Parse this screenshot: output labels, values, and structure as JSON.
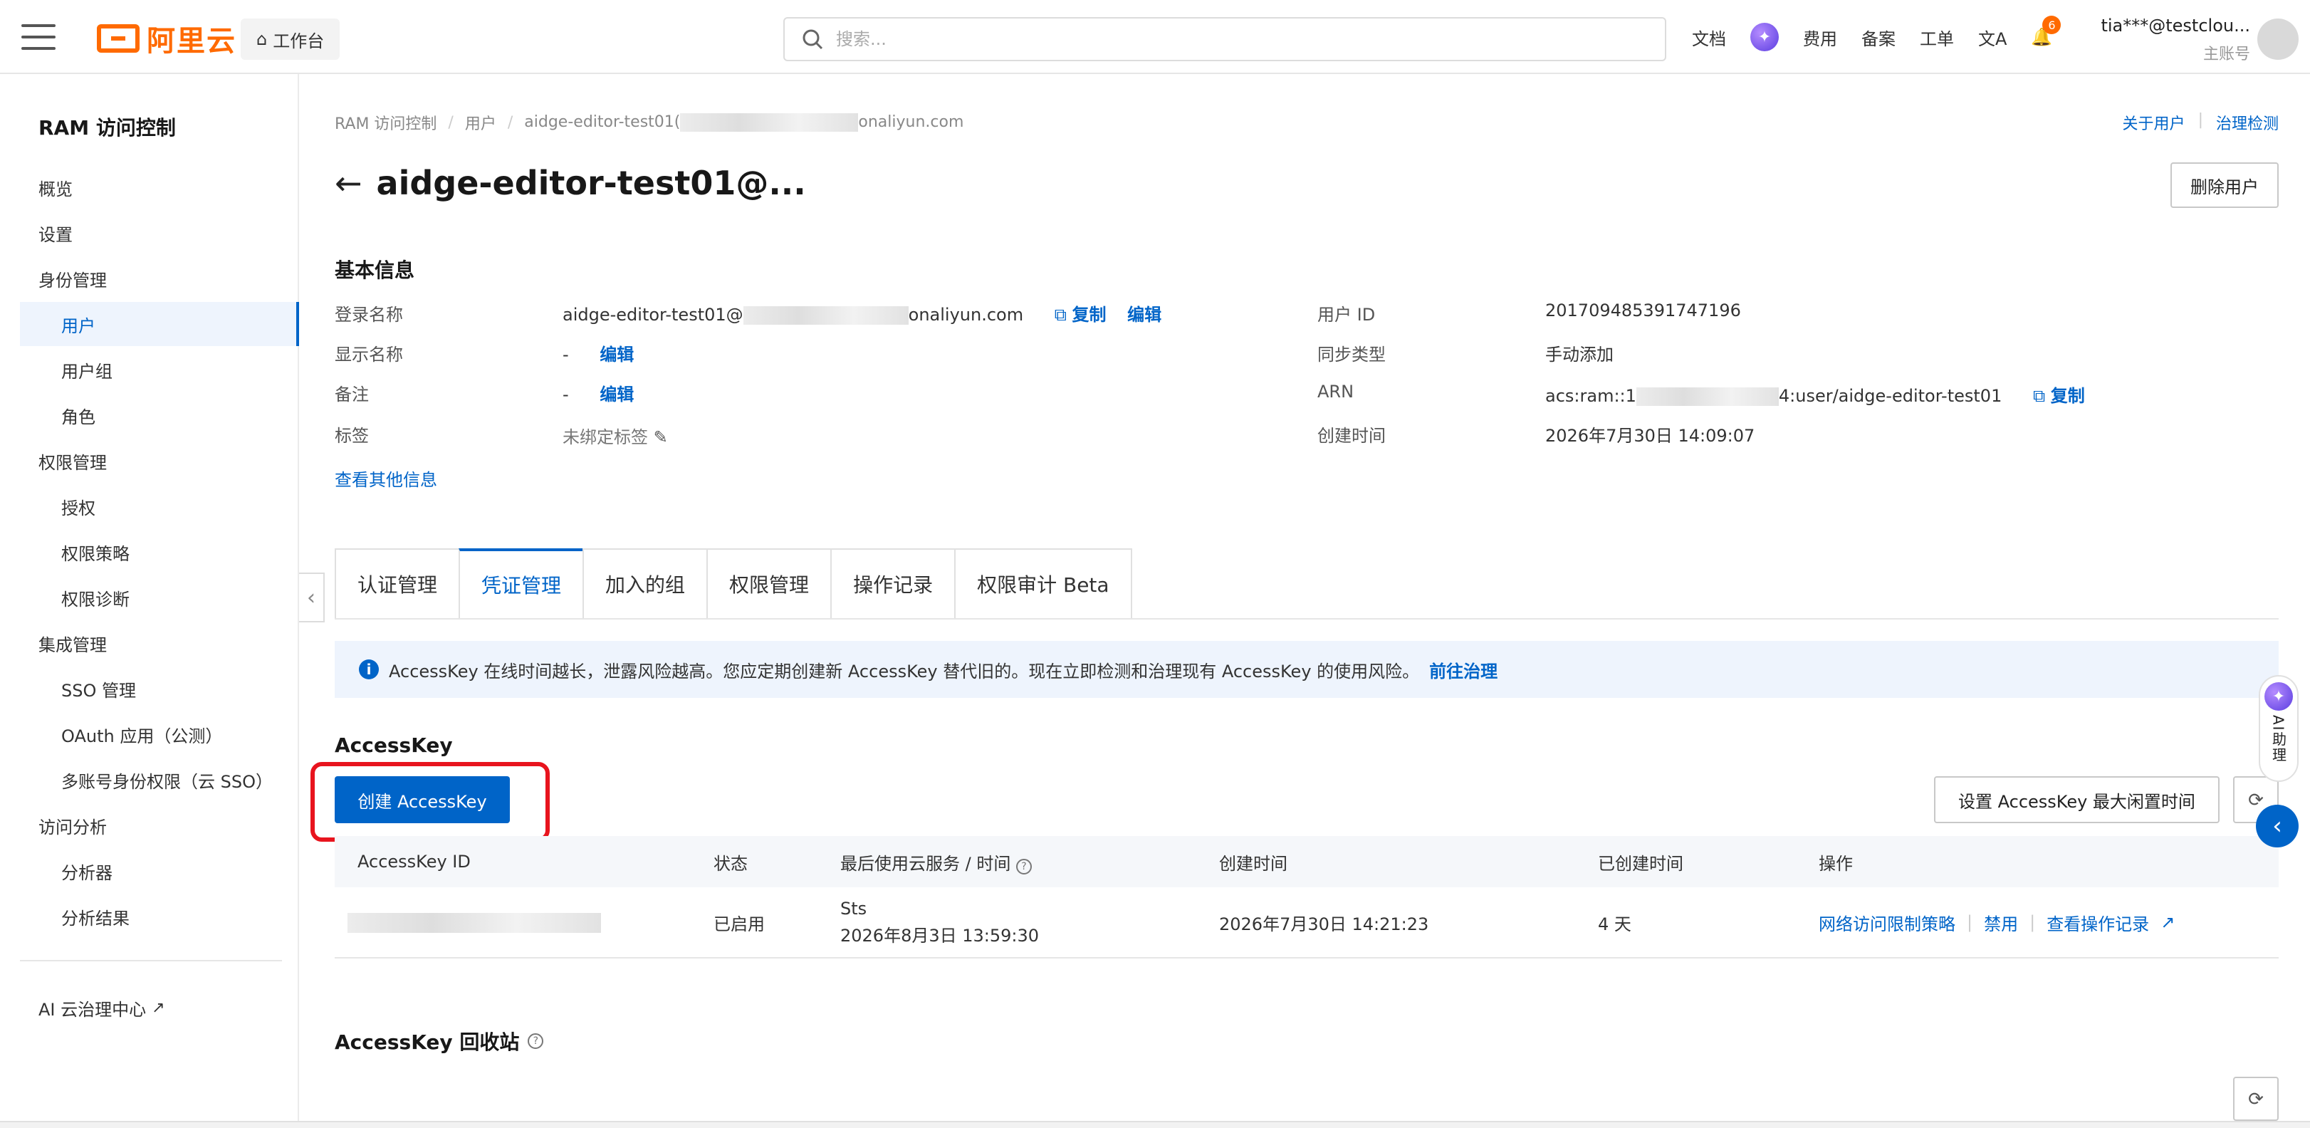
{
  "topbar": {
    "logo_text": "阿里云",
    "workbench": "工作台",
    "search_placeholder": "搜索...",
    "nav": [
      "文档",
      "费用",
      "备案",
      "工单"
    ],
    "bell_count": "6",
    "account_name": "tia***@testclou...",
    "account_sub": "主账号"
  },
  "sidebar": {
    "title": "RAM 访问控制",
    "items": [
      {
        "label": "概览",
        "level": "group"
      },
      {
        "label": "设置",
        "level": "group"
      },
      {
        "label": "身份管理",
        "level": "group"
      },
      {
        "label": "用户",
        "level": "sub",
        "active": true
      },
      {
        "label": "用户组",
        "level": "sub"
      },
      {
        "label": "角色",
        "level": "sub"
      },
      {
        "label": "权限管理",
        "level": "group"
      },
      {
        "label": "授权",
        "level": "sub"
      },
      {
        "label": "权限策略",
        "level": "sub"
      },
      {
        "label": "权限诊断",
        "level": "sub"
      },
      {
        "label": "集成管理",
        "level": "group"
      },
      {
        "label": "SSO 管理",
        "level": "sub"
      },
      {
        "label": "OAuth 应用（公测）",
        "level": "sub"
      },
      {
        "label": "多账号身份权限（云 SSO）",
        "level": "sub"
      },
      {
        "label": "访问分析",
        "level": "group"
      },
      {
        "label": "分析器",
        "level": "sub"
      },
      {
        "label": "分析结果",
        "level": "sub"
      }
    ],
    "footer_link": "AI 云治理中心"
  },
  "breadcrumb": {
    "items": [
      "RAM 访问控制",
      "用户"
    ],
    "current_prefix": "aidge-editor-test01(",
    "current_suffix": "onaliyun.com"
  },
  "toplinks": {
    "about": "关于用户",
    "check": "治理检测"
  },
  "page": {
    "title": "aidge-editor-test01@...",
    "delete_button": "删除用户"
  },
  "basic": {
    "section_title": "基本信息",
    "login_name_label": "登录名称",
    "login_name_prefix": "aidge-editor-test01@",
    "login_name_suffix": "onaliyun.com",
    "copy": "复制",
    "edit": "编辑",
    "display_name_label": "显示名称",
    "display_name_value": "-",
    "note_label": "备注",
    "note_value": "-",
    "tags_label": "标签",
    "tags_value": "未绑定标签",
    "more_info": "查看其他信息",
    "user_id_label": "用户 ID",
    "user_id_value": "201709485391747196",
    "sync_label": "同步类型",
    "sync_value": "手动添加",
    "arn_label": "ARN",
    "arn_prefix": "acs:ram::1",
    "arn_suffix": "4:user/aidge-editor-test01",
    "created_label": "创建时间",
    "created_value": "2026年7月30日 14:09:07"
  },
  "tabs": [
    "认证管理",
    "凭证管理",
    "加入的组",
    "权限管理",
    "操作记录",
    "权限审计 Beta"
  ],
  "notice": {
    "text": "AccessKey 在线时间越长，泄露风险越高。您应定期创建新 AccessKey 替代旧的。现在立即检测和治理现有 AccessKey 的使用风险。",
    "link": "前往治理"
  },
  "accesskey": {
    "title": "AccessKey",
    "create_button": "创建 AccessKey",
    "set_button": "设置 AccessKey 最大闲置时间",
    "columns": [
      "AccessKey ID",
      "状态",
      "最后使用云服务 / 时间",
      "创建时间",
      "已创建时间",
      "操作"
    ],
    "rows": [
      {
        "status": "已启用",
        "last_service": "Sts",
        "last_time": "2026年8月3日 13:59:30",
        "created": "2026年7月30日 14:21:23",
        "age": "4 天",
        "actions": [
          "网络访问限制策略",
          "禁用",
          "查看操作记录"
        ]
      }
    ],
    "recycle_title": "AccessKey 回收站"
  },
  "ai_assistant": {
    "label": "AI助理"
  }
}
